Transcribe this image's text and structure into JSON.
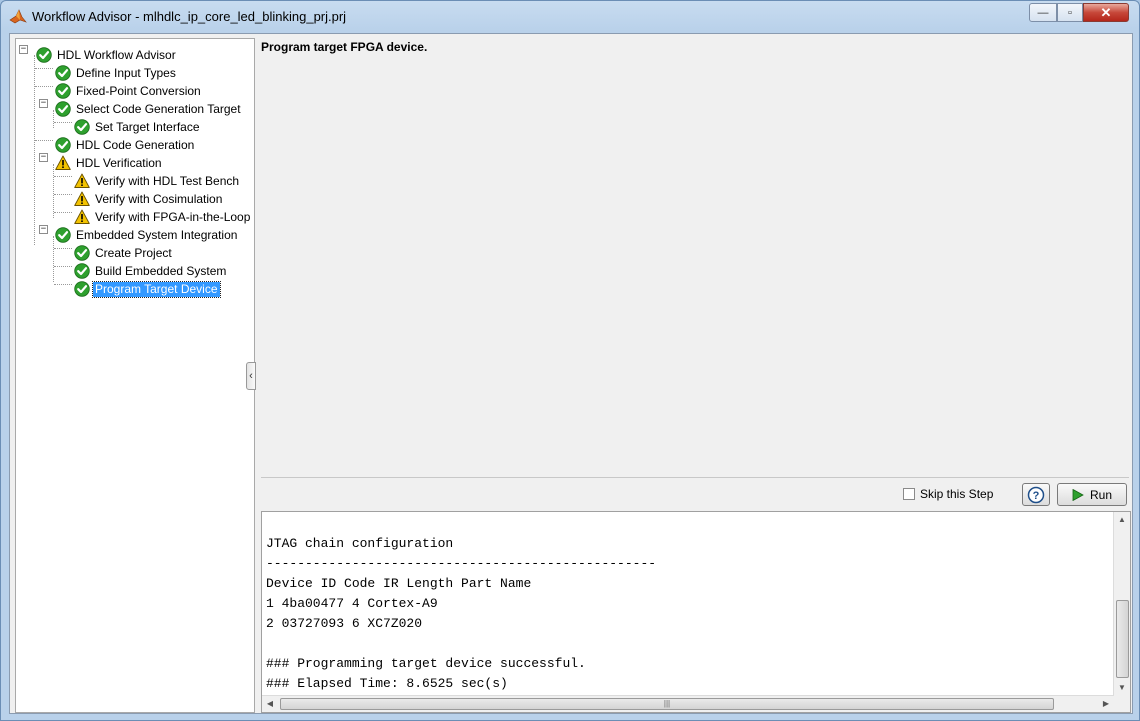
{
  "window": {
    "title": "Workflow Advisor - mlhdlc_ip_core_led_blinking_prj.prj",
    "minimize": "—",
    "maximize": "▫",
    "close": "✕"
  },
  "tree": {
    "items": [
      {
        "label": "HDL Workflow Advisor",
        "status": "check"
      },
      {
        "label": "Define Input Types",
        "status": "check"
      },
      {
        "label": "Fixed-Point Conversion",
        "status": "check"
      },
      {
        "label": "Select Code Generation Target",
        "status": "check"
      },
      {
        "label": "Set Target Interface",
        "status": "check"
      },
      {
        "label": "HDL Code Generation",
        "status": "check"
      },
      {
        "label": "HDL Verification",
        "status": "warning"
      },
      {
        "label": "Verify with HDL Test Bench",
        "status": "warning"
      },
      {
        "label": "Verify with Cosimulation",
        "status": "warning"
      },
      {
        "label": "Verify with FPGA-in-the-Loop",
        "status": "warning"
      },
      {
        "label": "Embedded System Integration",
        "status": "check"
      },
      {
        "label": "Create Project",
        "status": "check"
      },
      {
        "label": "Build Embedded System",
        "status": "check"
      },
      {
        "label": "Program Target Device",
        "status": "check",
        "selected": true
      }
    ]
  },
  "step": {
    "header": "Program target FPGA device.",
    "skip_label": "Skip this Step",
    "run_label": "Run"
  },
  "console": {
    "lines": [
      "JTAG chain configuration",
      "--------------------------------------------------",
      "Device ID Code IR Length Part Name",
      "1 4ba00477 4 Cortex-A9",
      "2 03727093 6 XC7Z020",
      "",
      "### Programming target device successful.",
      "### Elapsed Time: 8.6525 sec(s)"
    ]
  },
  "colors": {
    "check_green": "#2ea02e",
    "warning_yellow": "#f2c200",
    "selection_blue": "#3399ff"
  }
}
